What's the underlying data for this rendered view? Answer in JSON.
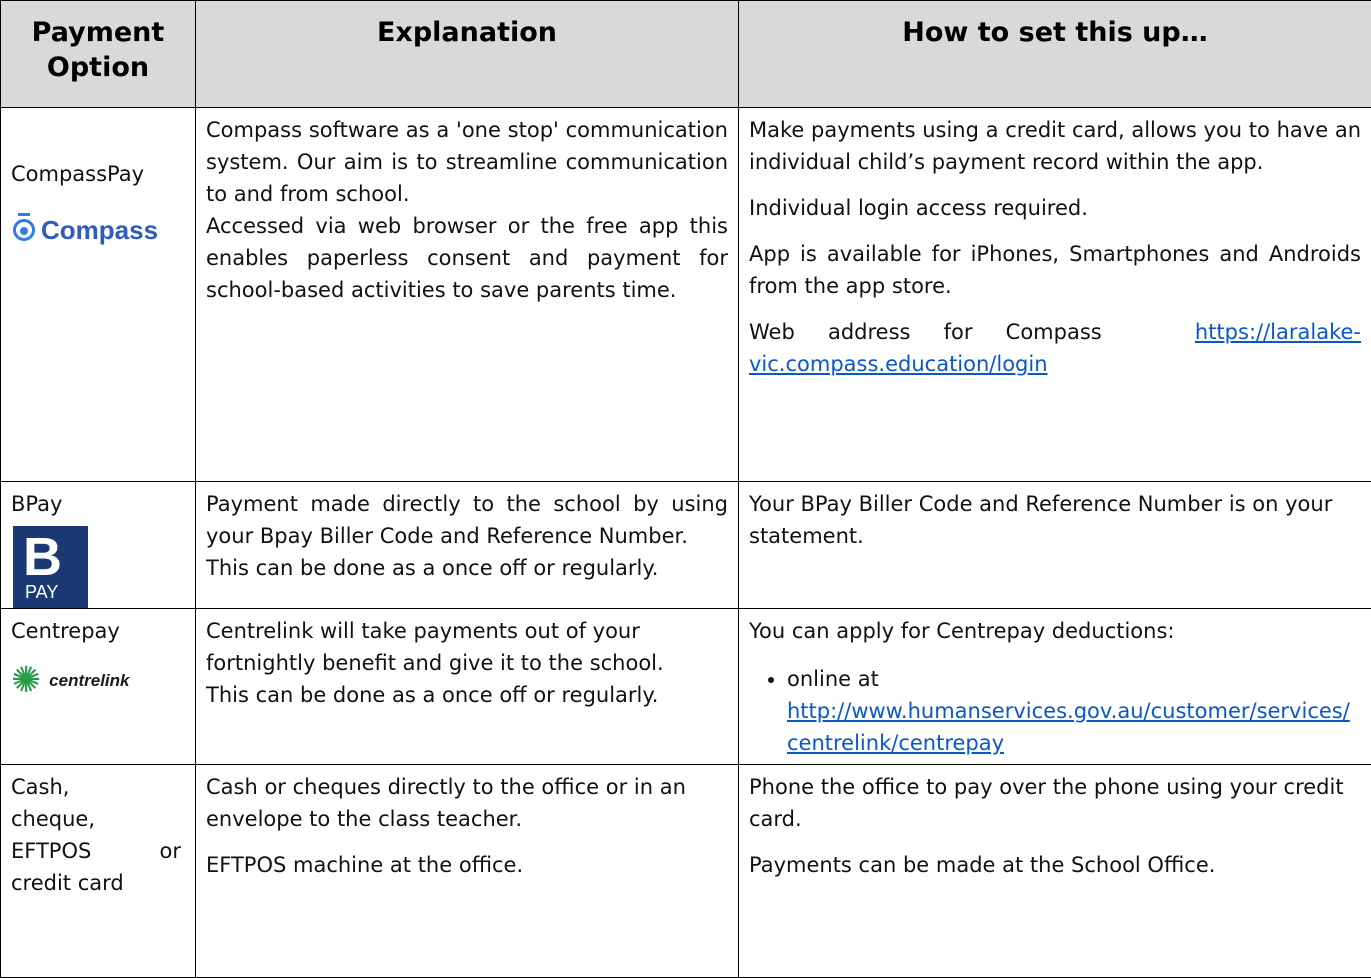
{
  "headers": {
    "payment_option": "Payment Option",
    "explanation": "Explanation",
    "how_to": "How to set this up…"
  },
  "rows": [
    {
      "option": "CompassPay",
      "logo_text": "Compass",
      "explanation": [
        "Compass software as a 'one stop' communication system. Our aim is to streamline communication to and from school.",
        "Accessed via web browser or the free app this enables paperless consent and payment for school-based activities to save parents time."
      ],
      "how": [
        "Make payments using a credit card, allows you to have an individual child’s payment record within the app.",
        "Individual login access required.",
        "App is available for iPhones, Smartphones and Androids from the app store."
      ],
      "web_label": "Web address for Compass",
      "web_link": "https://laralake-vic.compass.education/login"
    },
    {
      "option": "BPay",
      "logo_text_top": "B",
      "logo_text_bottom": "PAY",
      "explanation": [
        "Payment made directly to the school by using your Bpay Biller Code and Reference Number.",
        "This can be done as a once off or regularly."
      ],
      "how": [
        "Your BPay Biller Code and Reference Number is on your statement."
      ]
    },
    {
      "option": "Centrepay",
      "logo_text": "centrelink",
      "explanation": [
        "Centrelink will take payments out of your fortnightly benefit and give it to the school.",
        "This can be done as a once off or regularly."
      ],
      "how_intro": "You can apply for Centrepay deductions:",
      "bullet_text": "online at",
      "bullet_link": "http://www.humanservices.gov.au/customer/services/centrelink/centrepay"
    },
    {
      "option_lines": [
        "Cash,",
        "cheque,",
        "EFTPOS",
        "or",
        "credit card"
      ],
      "explanation": [
        "Cash or cheques directly to the office or in an envelope to the class teacher.",
        "EFTPOS machine at the office."
      ],
      "how": [
        "Phone the office to pay over the phone using your credit card.",
        "Payments can be made at the School Office."
      ]
    }
  ],
  "colors": {
    "header_bg": "#d9d9d9",
    "link": "#0a58c6",
    "compass_blue": "#2f5bbf",
    "bpay_navy": "#1b3a73"
  }
}
